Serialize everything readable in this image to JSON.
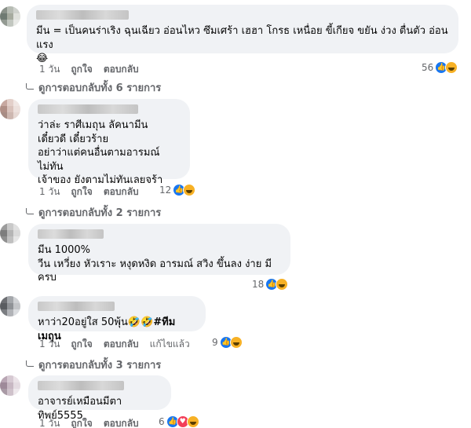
{
  "comments": [
    {
      "text": "มีน = เป็นคนร่าเริง ฉุนเฉียว อ่อนไหว ซึมเศร้า เฮฮา โกรธ เหนื่อย ขี้เกียจ ขยัน ง่วง ตื่นตัว อ่อนแรง",
      "emoji": "😂",
      "time": "1 วัน",
      "like_label": "ถูกใจ",
      "reply_label": "ตอบกลับ",
      "reaction_count": "56",
      "view_replies": "ดูการตอบกลับทั้ง 6 รายการ"
    },
    {
      "text": "ว่าล่ะ ราศีเมถุน ลัคนามีน\nเดี๋ยวดี เดี๋ยวร้าย\nอย่าว่าแต่คนอื่นตามอารมณ์ไม่ทัน\nเจ้าของ ยังตามไม่ทันเลยจร้า",
      "time": "1 วัน",
      "like_label": "ถูกใจ",
      "reply_label": "ตอบกลับ",
      "reaction_count": "12",
      "view_replies": "ดูการตอบกลับทั้ง 2 รายการ"
    },
    {
      "text": "มีน 1000%\nวีน เหวี่ยง หัวเราะ หงุดหงิด อารมณ์ สวิง ขึ้นลง ง่าย มีครบ",
      "reaction_count": "18"
    },
    {
      "text": "หาว่า20อยู่ใส 50พุ้น🤣🤣",
      "hashtag": "#ทีมเมถุน",
      "time": "1 วัน",
      "like_label": "ถูกใจ",
      "reply_label": "ตอบกลับ",
      "edited_label": "แก้ไขแล้ว",
      "reaction_count": "9",
      "view_replies": "ดูการตอบกลับทั้ง 3 รายการ"
    },
    {
      "text": "อาจารย์เหมือนมีตาทิพย์5555",
      "time": "1 วัน",
      "like_label": "ถูกใจ",
      "reply_label": "ตอบกลับ",
      "reaction_count": "6"
    }
  ],
  "colors": {
    "bubble": "#f0f2f5",
    "meta_text": "#65676b",
    "like_blue": "#1877f2",
    "haha_yellow": "#f7b125",
    "love_red": "#f33e58"
  },
  "icons": [
    "like-reaction-icon",
    "haha-reaction-icon",
    "love-reaction-icon",
    "reply-arrow-icon"
  ]
}
